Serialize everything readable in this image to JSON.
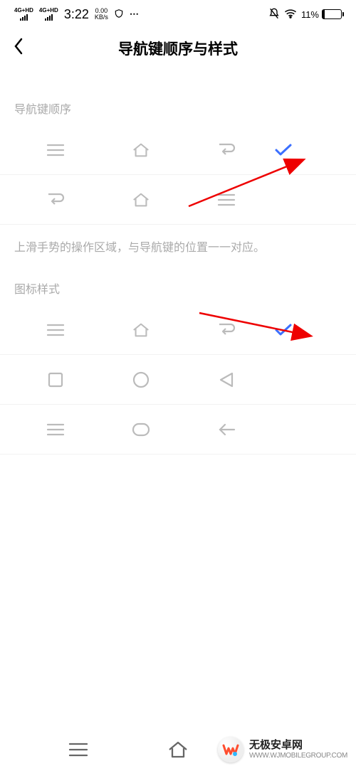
{
  "status": {
    "network_label": "4G+HD",
    "time": "3:22",
    "speed_top": "0.00",
    "speed_bottom": "KB/s",
    "battery_pct": "11%"
  },
  "header": {
    "title": "导航键顺序与样式"
  },
  "sections": {
    "order_label": "导航键顺序",
    "style_label": "图标样式",
    "hint": "上滑手势的操作区域，与导航键的位置一一对应。"
  },
  "order_options": [
    {
      "icons": [
        "hamburger",
        "home",
        "back"
      ],
      "selected": true
    },
    {
      "icons": [
        "back",
        "home",
        "hamburger"
      ],
      "selected": false
    }
  ],
  "style_options": [
    {
      "icons": [
        "hamburger",
        "home",
        "back"
      ],
      "selected": true
    },
    {
      "icons": [
        "square",
        "circle",
        "triangle"
      ],
      "selected": false
    },
    {
      "icons": [
        "hamburger",
        "rounded-square",
        "arrow-left"
      ],
      "selected": false
    }
  ],
  "watermark": {
    "title": "无极安卓网",
    "url": "WWW.WJMOBILEGROUP.COM"
  }
}
